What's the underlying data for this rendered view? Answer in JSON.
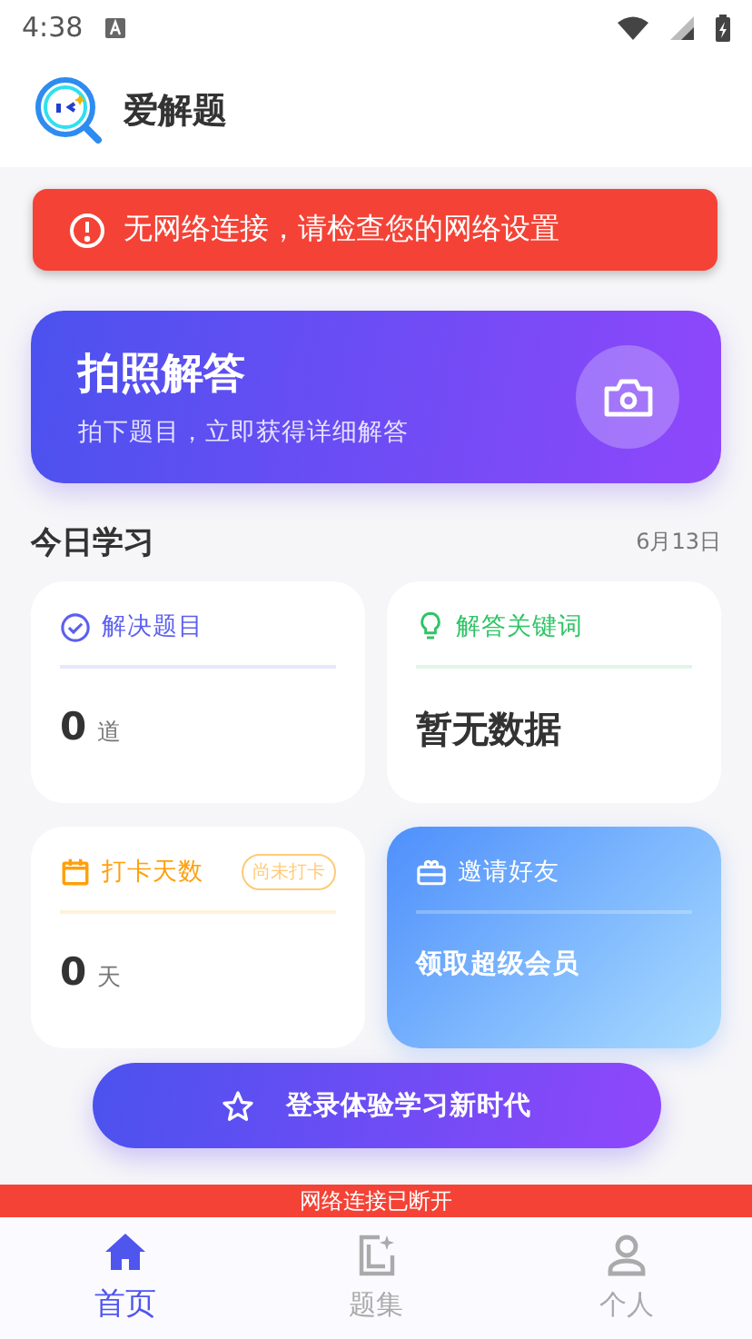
{
  "status_bar": {
    "time": "4:38"
  },
  "app_header": {
    "title": "爱解题"
  },
  "toast": {
    "message": "无网络连接，请检查您的网络设置"
  },
  "photo_card": {
    "title": "拍照解答",
    "subtitle": "拍下题目，立即获得详细解答"
  },
  "today": {
    "title": "今日学习",
    "date": "6月13日"
  },
  "cards": [
    {
      "kind": "stat",
      "title": "解决题目",
      "value": "0",
      "unit": "道",
      "color": "#5b5ff0"
    },
    {
      "kind": "text",
      "title": "解答关键词",
      "value": "暂无数据",
      "color": "#2fc465"
    },
    {
      "kind": "stat",
      "title": "打卡天数",
      "value": "0",
      "unit": "天",
      "badge": "尚未打卡",
      "color": "#ff9f0a"
    },
    {
      "kind": "invite",
      "title": "邀请好友",
      "value": "领取超级会员"
    }
  ],
  "login_button": {
    "label": "登录体验学习新时代"
  },
  "offline_bar": {
    "text": "网络连接已断开"
  },
  "tabs": [
    {
      "label": "首页",
      "selected": true
    },
    {
      "label": "题集",
      "selected": false
    },
    {
      "label": "个人",
      "selected": false
    }
  ]
}
